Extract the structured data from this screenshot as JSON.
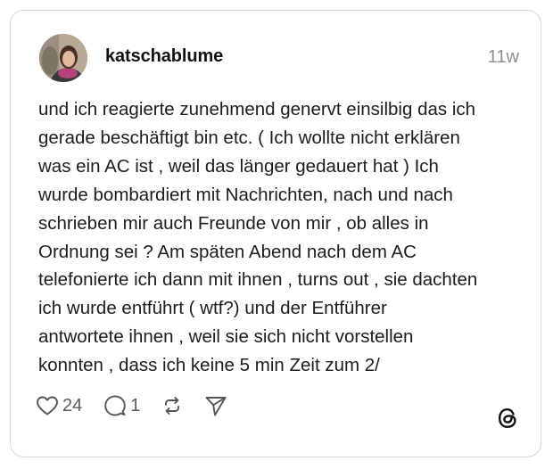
{
  "post": {
    "username": "katschablume",
    "timestamp": "11w",
    "text_lines": [
      "und ich reagierte zunehmend genervt einsilbig das ich",
      "gerade beschäftigt bin etc. ( Ich wollte nicht erklären",
      "was ein AC ist , weil das länger gedauert hat ) Ich",
      "wurde bombardiert mit Nachrichten, nach und nach",
      "schrieben mir auch Freunde von mir , ob alles in",
      "Ordnung sei ? Am späten Abend nach dem AC",
      "telefonierte ich dann mit ihnen , turns out , sie dachten",
      "ich wurde entführt ( wtf?) und der Entführer",
      "antwortete ihnen , weil sie sich nicht vorstellen",
      "konnten , dass ich keine 5 min Zeit zum 2/"
    ]
  },
  "actions": {
    "like_count": "24",
    "comment_count": "1",
    "like_icon": "heart-icon",
    "comment_icon": "comment-bubble-icon",
    "repost_icon": "repost-icon",
    "share_icon": "send-icon"
  },
  "branding": {
    "logo_icon": "threads-logo-icon"
  }
}
